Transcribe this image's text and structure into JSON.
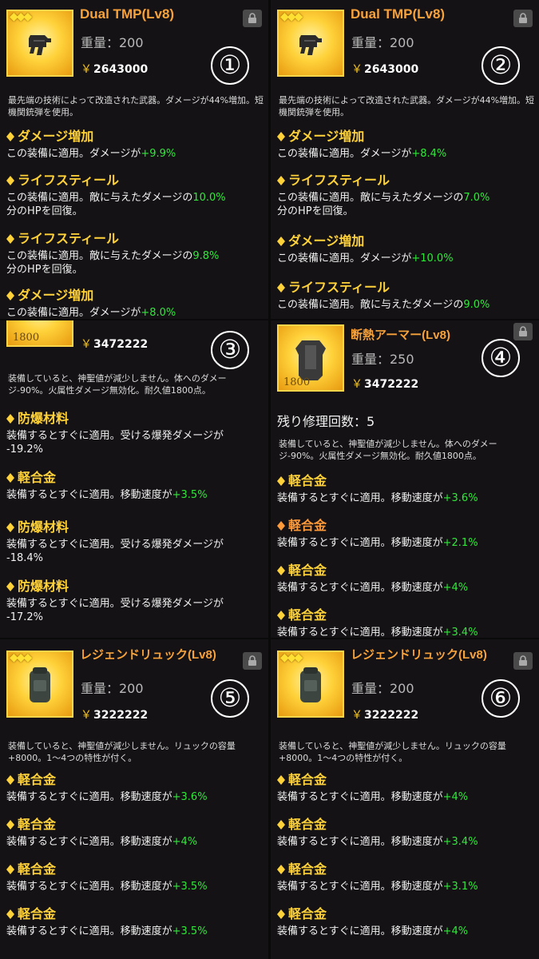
{
  "common": {
    "yen": "￥",
    "lock_icon": "lock-icon",
    "diamond_icon": "diamond-icon"
  },
  "panels": [
    {
      "number": "①",
      "name": "Dual TMP(Lv8)",
      "weight": "重量：200",
      "price": "2643000",
      "stars": "◆◆◆",
      "description": "最先端の技術によって改造された武器。ダメージが44%増加。短機関銃弾を使用。",
      "traits": [
        {
          "title": "ダメージ増加",
          "text": "この装備に適用。ダメージが",
          "value": "+9.9%"
        },
        {
          "title": "ライフスティール",
          "text": "この装備に適用。敵に与えたダメージの",
          "value": "10.0%",
          "text2": "分のHPを回復。"
        },
        {
          "title": "ライフスティール",
          "text": "この装備に適用。敵に与えたダメージの",
          "value": "9.8%",
          "text2": "分のHPを回復。"
        },
        {
          "title": "ダメージ増加",
          "text": "この装備に適用。ダメージが",
          "value": "+8.0%"
        }
      ]
    },
    {
      "number": "②",
      "name": "Dual TMP(Lv8)",
      "weight": "重量：200",
      "price": "2643000",
      "stars": "◆◆◆",
      "description": "最先端の技術によって改造された武器。ダメージが44%増加。短機関銃弾を使用。",
      "traits": [
        {
          "title": "ダメージ増加",
          "text": "この装備に適用。ダメージが",
          "value": "+8.4%"
        },
        {
          "title": "ライフスティール",
          "text": "この装備に適用。敵に与えたダメージの",
          "value": "7.0%",
          "text2": "分のHPを回復。"
        },
        {
          "title": "ダメージ増加",
          "text": "この装備に適用。ダメージが",
          "value": "+10.0%"
        },
        {
          "title": "ライフスティール",
          "text": "この装備に適用。敵に与えたダメージの",
          "value": "9.0%"
        }
      ]
    },
    {
      "number": "③",
      "price": "3472222",
      "durability": "1800",
      "description": "装備していると、神聖値が減少しません。体へのダメージ-90%。火属性ダメージ無効化。耐久値1800点。",
      "traits": [
        {
          "title": "防爆材料",
          "text": "装備するとすぐに適用。受ける爆発ダメージが",
          "value": "-19.2%"
        },
        {
          "title": "軽合金",
          "text": "装備するとすぐに適用。移動速度が",
          "value": "+3.5%"
        },
        {
          "title": "防爆材料",
          "text": "装備するとすぐに適用。受ける爆発ダメージが",
          "value": "-18.4%"
        },
        {
          "title": "防爆材料",
          "text": "装備するとすぐに適用。受ける爆発ダメージが",
          "value": "-17.2%"
        }
      ]
    },
    {
      "number": "④",
      "name": "断熱アーマー(Lv8)",
      "weight": "重量：250",
      "price": "3472222",
      "durability": "1800",
      "repair": "残り修理回数：5",
      "description": "装備していると、神聖値が減少しません。体へのダメージ-90%。火属性ダメージ無効化。耐久値1800点。",
      "traits": [
        {
          "title": "軽合金",
          "text": "装備するとすぐに適用。移動速度が",
          "value": "+3.6%"
        },
        {
          "title": "軽合金",
          "text": "装備するとすぐに適用。移動速度が",
          "value": "+2.1%"
        },
        {
          "title": "軽合金",
          "text": "装備するとすぐに適用。移動速度が",
          "value": "+4%"
        },
        {
          "title": "軽合金",
          "text": "装備するとすぐに適用。移動速度が",
          "value": "+3.4%"
        }
      ]
    },
    {
      "number": "⑤",
      "name": "レジェンドリュック(Lv8)",
      "weight": "重量：200",
      "price": "3222222",
      "stars": "◆◆◆",
      "description": "装備していると、神聖値が減少しません。リュックの容量+8000。1～4つの特性が付く。",
      "traits": [
        {
          "title": "軽合金",
          "text": "装備するとすぐに適用。移動速度が",
          "value": "+3.6%"
        },
        {
          "title": "軽合金",
          "text": "装備するとすぐに適用。移動速度が",
          "value": "+4%"
        },
        {
          "title": "軽合金",
          "text": "装備するとすぐに適用。移動速度が",
          "value": "+3.5%"
        },
        {
          "title": "軽合金",
          "text": "装備するとすぐに適用。移動速度が",
          "value": "+3.5%"
        }
      ]
    },
    {
      "number": "⑥",
      "name": "レジェンドリュック(Lv8)",
      "weight": "重量：200",
      "price": "3222222",
      "stars": "◆◆◆",
      "description": "装備していると、神聖値が減少しません。リュックの容量+8000。1～4つの特性が付く。",
      "traits": [
        {
          "title": "軽合金",
          "text": "装備するとすぐに適用。移動速度が",
          "value": "+4%"
        },
        {
          "title": "軽合金",
          "text": "装備するとすぐに適用。移動速度が",
          "value": "+3.4%"
        },
        {
          "title": "軽合金",
          "text": "装備するとすぐに適用。移動速度が",
          "value": "+3.1%"
        },
        {
          "title": "軽合金",
          "text": "装備するとすぐに適用。移動速度が",
          "value": "+4%"
        }
      ]
    }
  ]
}
